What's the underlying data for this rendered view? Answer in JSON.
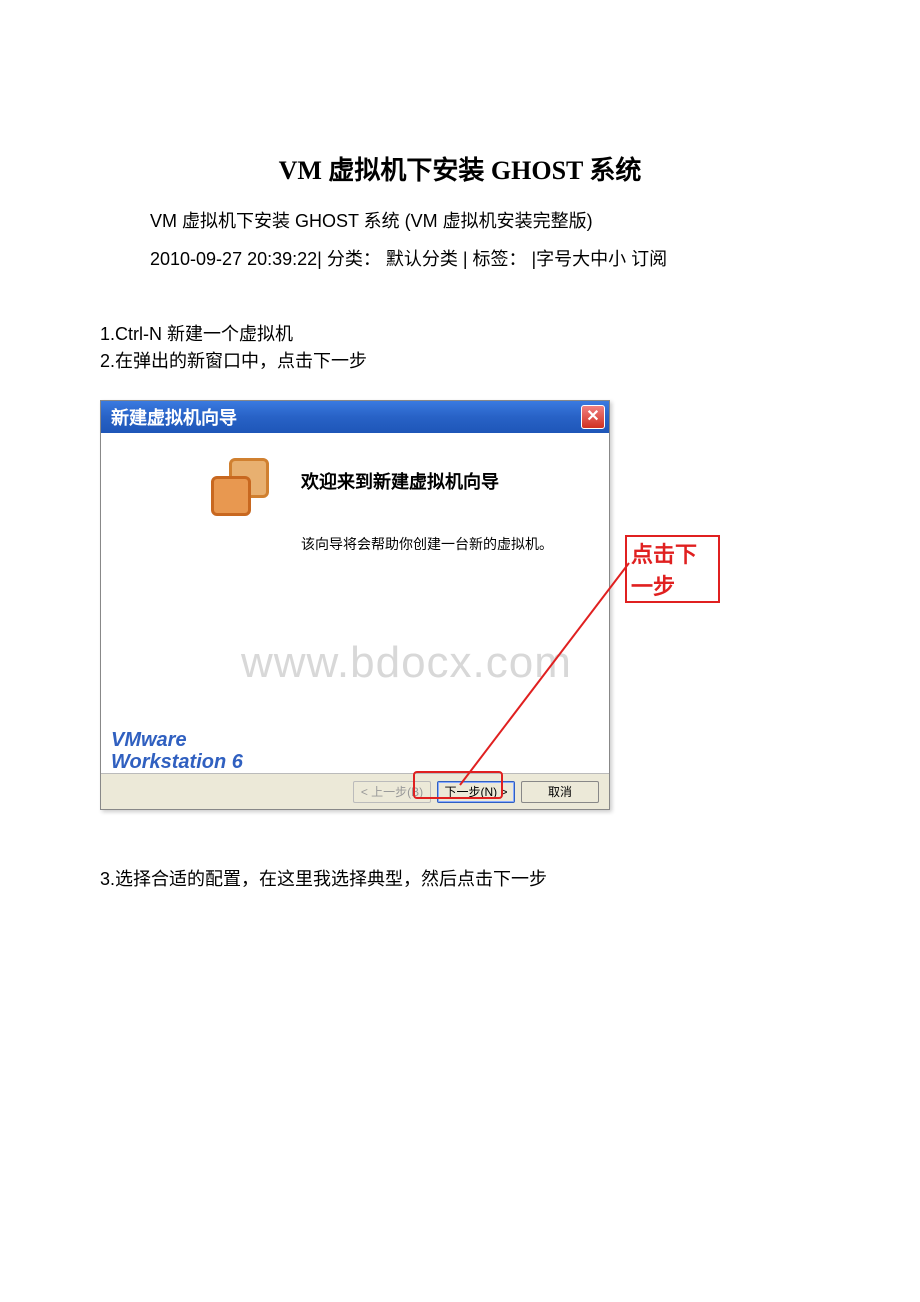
{
  "document": {
    "title": "VM 虚拟机下安装 GHOST 系统",
    "subtitle": "VM 虚拟机下安装 GHOST 系统 (VM 虚拟机安装完整版)",
    "meta": "2010-09-27 20:39:22| 分类： 默认分类 | 标签： |字号大中小 订阅",
    "steps": {
      "s1": "1.Ctrl-N 新建一个虚拟机",
      "s2": "2.在弹出的新窗口中，点击下一步",
      "s3": "3.选择合适的配置，在这里我选择典型，然后点击下一步"
    }
  },
  "wizard": {
    "title": "新建虚拟机向导",
    "welcome": "欢迎来到新建虚拟机向导",
    "description": "该向导将会帮助你创建一台新的虚拟机。",
    "brand_line1": "VMware",
    "brand_line2": "Workstation 6",
    "buttons": {
      "back": "< 上一步(B)",
      "next": "下一步(N) >",
      "cancel": "取消"
    }
  },
  "annotation": {
    "click_next": "点击下一步"
  },
  "watermark": "www.bdocx.com"
}
